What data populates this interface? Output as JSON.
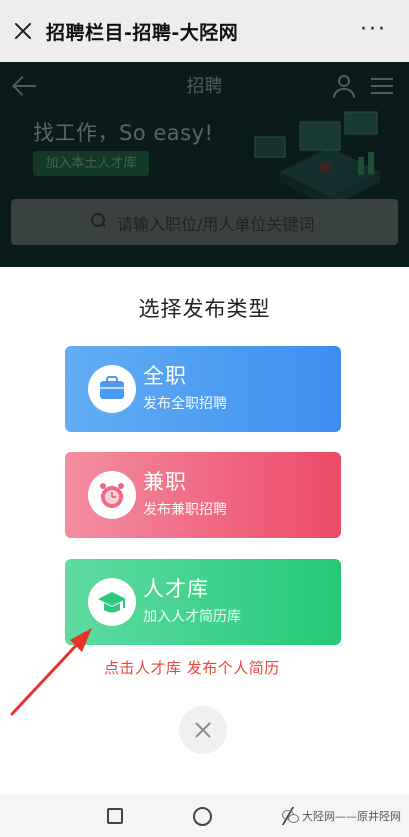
{
  "wechat": {
    "title": "招聘栏目-招聘-大陉网",
    "more": "···"
  },
  "app": {
    "title": "招聘",
    "slogan": "找工作，So easy!",
    "join_button": "加入本土人才库",
    "search_placeholder": "请输入职位/用人单位关键词"
  },
  "modal": {
    "title": "选择发布类型",
    "options": [
      {
        "label": "全职",
        "sub": "发布全职招聘",
        "icon": "briefcase-icon"
      },
      {
        "label": "兼职",
        "sub": "发布兼职招聘",
        "icon": "alarm-clock-icon"
      },
      {
        "label": "人才库",
        "sub": "加入人才简历库",
        "icon": "graduation-cap-icon"
      }
    ],
    "hint": "点击人才库 发布个人简历"
  },
  "watermark": "大陉网——原井陉网",
  "colors": {
    "fulltime": "#4a9af2",
    "parttime": "#ef6a82",
    "talent": "#3dd08a",
    "hint": "#e8473a"
  }
}
